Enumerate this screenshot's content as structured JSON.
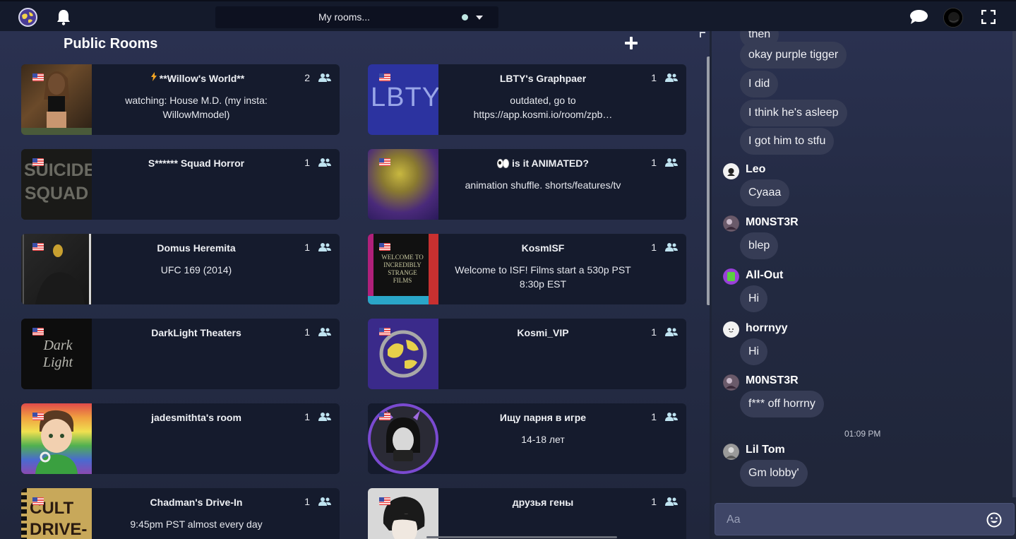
{
  "topbar": {
    "rooms_select_label": "My rooms...",
    "icons": [
      "app-logo",
      "bell-icon",
      "chat-bubble-icon",
      "user-avatar",
      "fullscreen-icon"
    ]
  },
  "rooms_panel": {
    "title": "Public Rooms",
    "rooms": [
      {
        "name": "**Willow's World**",
        "description": "watching: House M.D. (my insta: WillowMmodel)",
        "count": "2",
        "prefix_icon": "lightning-icon"
      },
      {
        "name": "LBTY's Graphpaer",
        "description": "outdated, go to https://app.kosmi.io/room/zpb…",
        "count": "1",
        "thumb_text": "LBTY"
      },
      {
        "name": "S****** Squad Horror",
        "description": "",
        "count": "1",
        "thumb_text": "SUICIDE SQUAD"
      },
      {
        "name": "is it ANIMATED?",
        "description": "animation shuffle. shorts/features/tv",
        "count": "1",
        "prefix_icon": "eyes-icon"
      },
      {
        "name": "Domus Heremita",
        "description": "UFC 169 (2014)",
        "count": "1"
      },
      {
        "name": "KosmISF",
        "description": "Welcome to ISF! Films start a 530p PST 8:30p EST",
        "count": "1",
        "thumb_text": "WELCOME TO INCREDIBLY STRANGE FILMS"
      },
      {
        "name": "DarkLight Theaters",
        "description": "",
        "count": "1",
        "thumb_text": "Dark Light"
      },
      {
        "name": "Kosmi_VIP",
        "description": "",
        "count": "1"
      },
      {
        "name": "jadesmithta's room",
        "description": "",
        "count": "1"
      },
      {
        "name": "Ищу парня в игре",
        "description": "14-18 лет",
        "count": "1"
      },
      {
        "name": "Chadman's Drive-In",
        "description": "9:45pm PST almost every day",
        "count": "1",
        "thumb_text": "CULT DRIVE-IN"
      },
      {
        "name": "друзья гены",
        "description": "",
        "count": "1"
      }
    ]
  },
  "chat": {
    "messages_top": [
      {
        "text": "then"
      },
      {
        "text": "okay purple tigger"
      },
      {
        "text": "I did"
      },
      {
        "text": "I think he's asleep"
      },
      {
        "text": "I got him to stfu"
      }
    ],
    "groups": [
      {
        "user": "Leo",
        "text": "Cyaaa"
      },
      {
        "user": "M0NST3R",
        "text": "blep"
      },
      {
        "user": "All-Out",
        "text": "Hi"
      },
      {
        "user": "horrnyy",
        "text": "Hi"
      },
      {
        "user": "M0NST3R",
        "text": "f*** off horrny"
      },
      {
        "user": "Lil Tom",
        "text": "Gm lobby'"
      }
    ],
    "timestamp": "01:09 PM",
    "input_placeholder": "Aa"
  }
}
